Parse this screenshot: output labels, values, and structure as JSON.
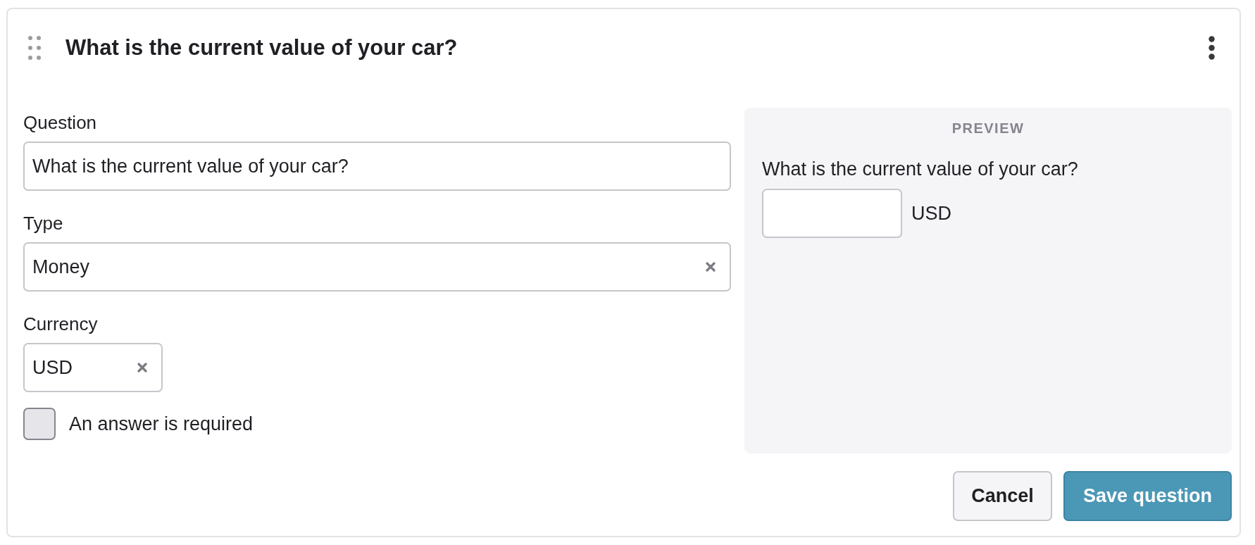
{
  "card": {
    "title": "What is the current value of your car?"
  },
  "form": {
    "question": {
      "label": "Question",
      "value": "What is the current value of your car?"
    },
    "type": {
      "label": "Type",
      "value": "Money"
    },
    "currency": {
      "label": "Currency",
      "value": "USD"
    },
    "required": {
      "label": "An answer is required",
      "checked": false
    }
  },
  "preview": {
    "heading": "PREVIEW",
    "question": "What is the current value of your car?",
    "unit": "USD"
  },
  "buttons": [
    {
      "label": "Cancel",
      "kind": "secondary"
    },
    {
      "label": "Save question",
      "kind": "primary"
    }
  ]
}
